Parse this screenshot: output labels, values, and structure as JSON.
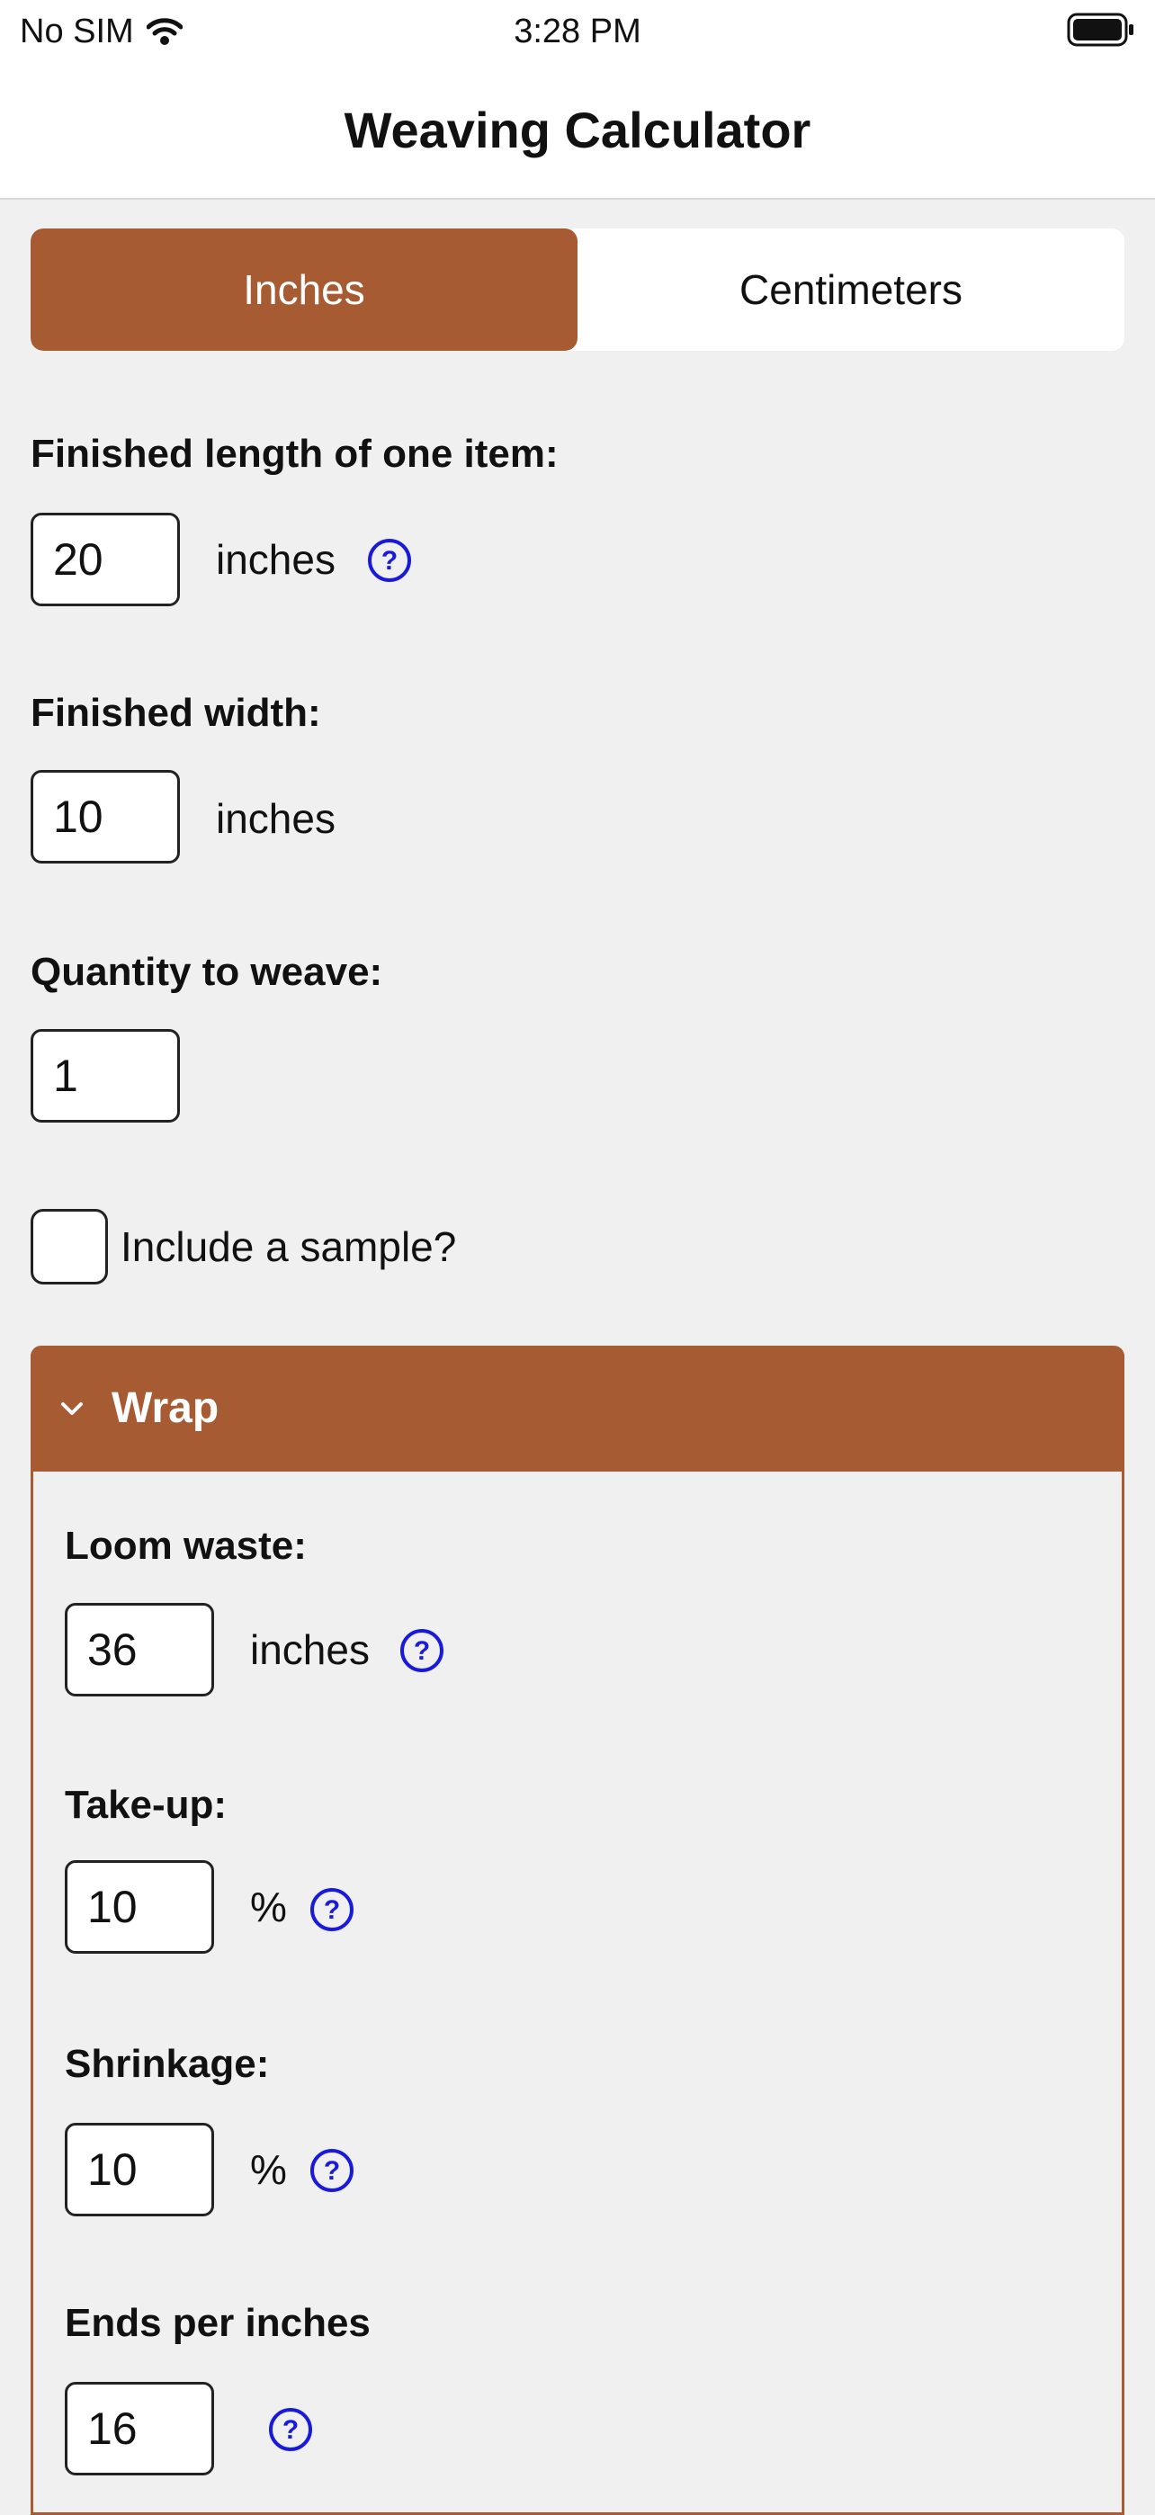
{
  "status_bar": {
    "carrier": "No SIM",
    "time": "3:28 PM"
  },
  "nav": {
    "title": "Weaving Calculator"
  },
  "units": {
    "options": [
      "Inches",
      "Centimeters"
    ],
    "selected": "Inches"
  },
  "fields": {
    "finished_length": {
      "label": "Finished length of one item:",
      "value": "20",
      "unit": "inches"
    },
    "finished_width": {
      "label": "Finished width:",
      "value": "10",
      "unit": "inches"
    },
    "quantity": {
      "label": "Quantity to weave:",
      "value": "1"
    },
    "sample": {
      "label": "Include a sample?",
      "checked": false
    }
  },
  "warp_section": {
    "title": "Wrap",
    "expanded": true,
    "loom_waste": {
      "label": "Loom waste:",
      "value": "36",
      "unit": "inches"
    },
    "take_up": {
      "label": "Take-up:",
      "value": "10",
      "unit": "%"
    },
    "shrinkage": {
      "label": "Shrinkage:",
      "value": "10",
      "unit": "%"
    },
    "ends_per": {
      "label": "Ends per inches",
      "value": "16"
    }
  },
  "colors": {
    "accent": "#a65b33",
    "help_icon": "#1a1adb",
    "background": "#f0f0f0"
  },
  "icons": {
    "help": "question-circle-icon",
    "collapse": "chevron-down-icon",
    "wifi": "wifi-icon",
    "battery": "battery-icon"
  }
}
